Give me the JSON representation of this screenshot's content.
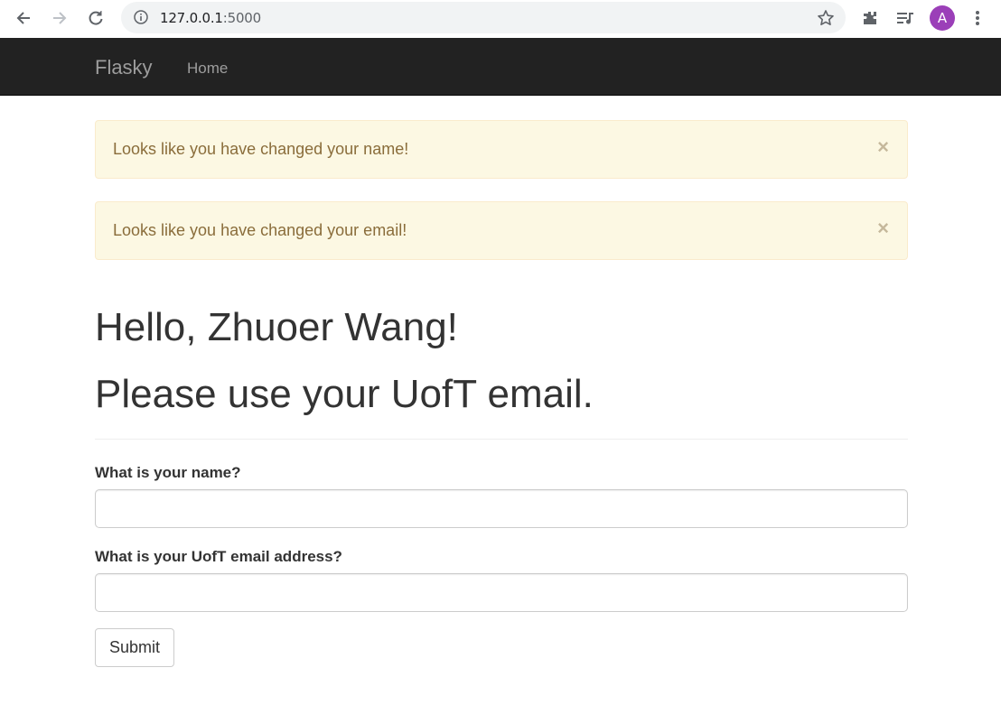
{
  "browser": {
    "url_host": "127.0.0.1",
    "url_port": ":5000",
    "avatar_letter": "A",
    "avatar_color": "#9b3fb8",
    "icons": [
      "back-arrow-icon",
      "forward-arrow-icon",
      "reload-icon",
      "info-icon",
      "star-icon",
      "extensions-icon",
      "media-control-icon",
      "more-vert-icon"
    ]
  },
  "navbar": {
    "brand": "Flasky",
    "home": "Home"
  },
  "alerts": [
    {
      "message": "Looks like you have changed your name!",
      "close": "×"
    },
    {
      "message": "Looks like you have changed your email!",
      "close": "×"
    }
  ],
  "header": {
    "greeting": "Hello, Zhuoer Wang!",
    "notice": "Please use your UofT email."
  },
  "form": {
    "name_label": "What is your name?",
    "name_value": "",
    "email_label": "What is your UofT email address?",
    "email_value": "",
    "submit": "Submit"
  },
  "colors": {
    "navbar_bg": "#222222",
    "alert_bg": "#fcf8e3",
    "alert_text": "#8a6d3b"
  }
}
